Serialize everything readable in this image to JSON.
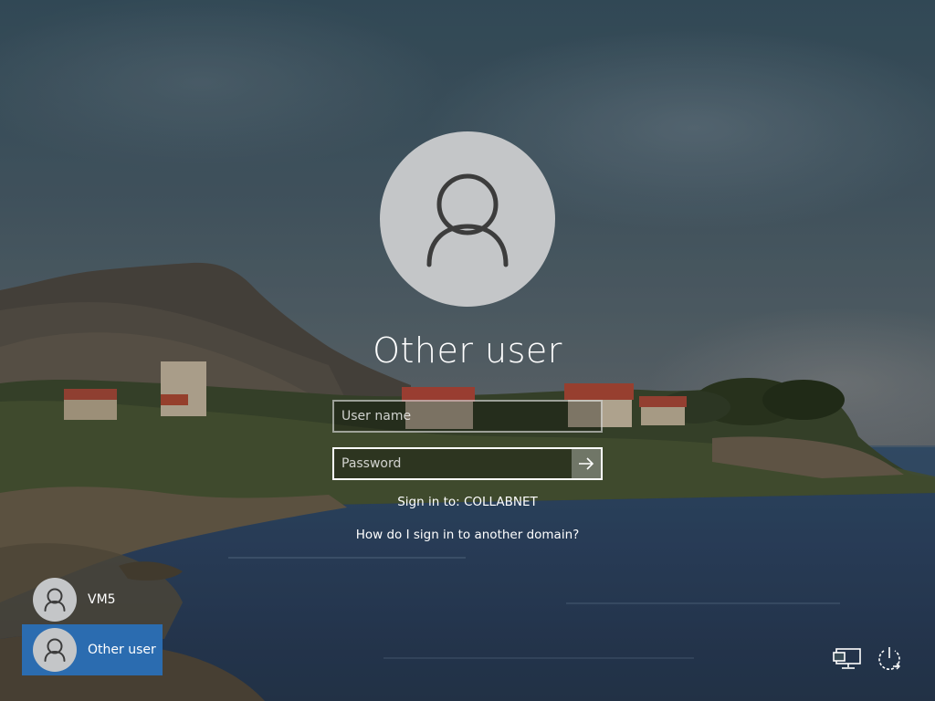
{
  "login": {
    "current_user": "Other user",
    "username_placeholder": "User name",
    "password_placeholder": "Password",
    "sign_in_to": "Sign in to: COLLABNET",
    "other_domain_link": "How do I sign in to another domain?"
  },
  "user_list": [
    {
      "label": "VM5",
      "selected": false
    },
    {
      "label": "Other user",
      "selected": true
    }
  ],
  "icons": {
    "avatar": "user-icon",
    "submit": "arrow-right-icon",
    "network": "network-icon",
    "power": "power-icon"
  },
  "colors": {
    "selected_tile": "#2b6cb0",
    "avatar_bg": "#c4c6c8",
    "avatar_fg": "#3c3c3c"
  }
}
